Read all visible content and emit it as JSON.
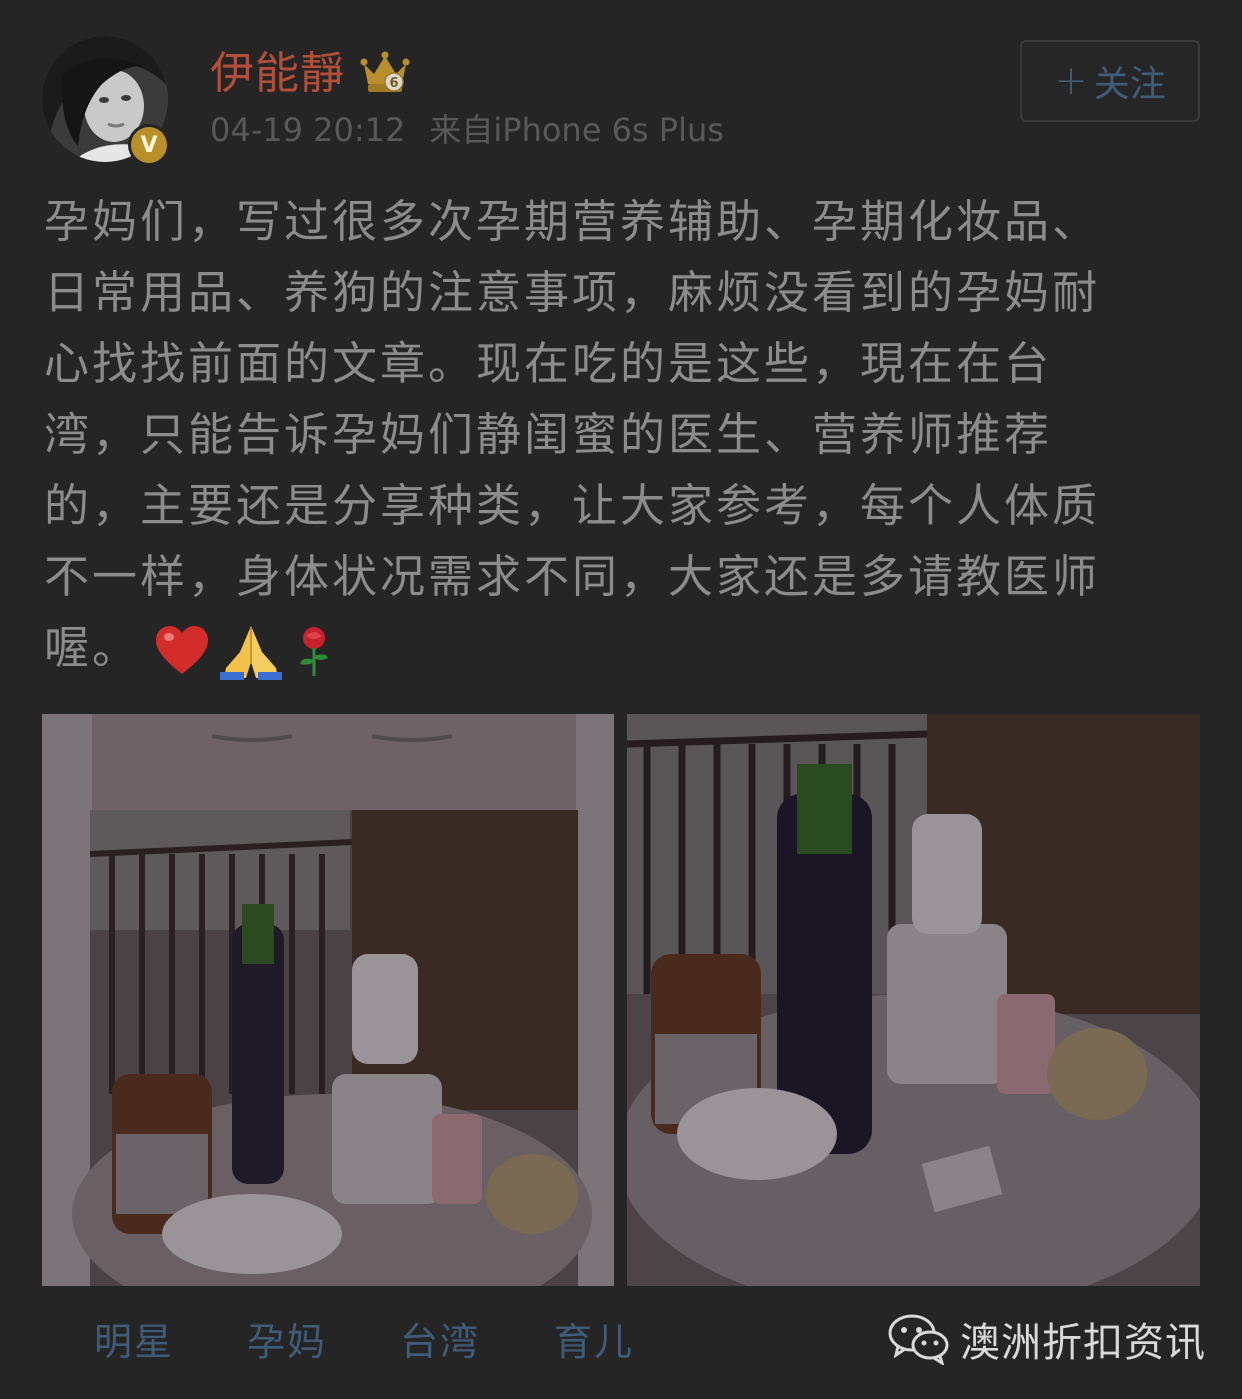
{
  "user": {
    "name": "伊能靜",
    "timestamp": "04-19 20:12",
    "source": "来自iPhone 6s Plus",
    "verified_badge": "V",
    "crown_badge_letter": "6"
  },
  "follow_button": {
    "plus": "+",
    "label": "关注"
  },
  "post": {
    "lines": [
      "孕妈们，写过很多次孕期营养辅助、孕期化妆品、",
      "日常用品、养狗的注意事项，麻烦没看到的孕妈耐",
      "心找找前面的文章。现在吃的是这些，現在在台",
      "湾，只能告诉孕妈们静闺蜜的医生、营养师推荐",
      "的，主要还是分享种类，让大家参考，每个人体质",
      "不一样，身体状况需求不同，大家还是多请教医师",
      "喔。"
    ],
    "emojis": [
      "heart-icon",
      "folded-hands-icon",
      "rose-icon"
    ]
  },
  "photos": [
    {
      "label": "supplements-on-balcony-table-photo-1"
    },
    {
      "label": "supplements-on-balcony-table-photo-2"
    }
  ],
  "tags": [
    "明星",
    "孕妈",
    "台湾",
    "育儿"
  ],
  "watermark": {
    "text": "澳洲折扣资讯",
    "icon": "wechat-icon"
  },
  "colors": {
    "background": "#252525",
    "username": "#b34e3a",
    "link": "#3f5c78",
    "body_text": "#8c8c8c",
    "meta_text": "#595959"
  }
}
